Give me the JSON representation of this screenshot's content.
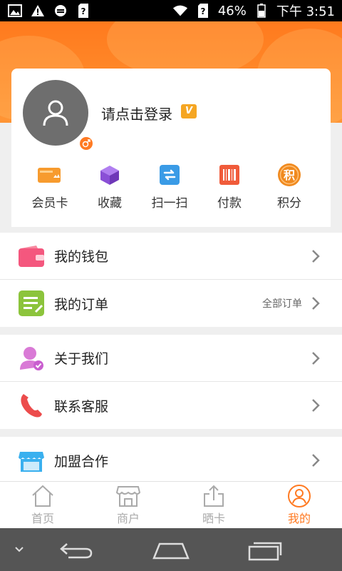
{
  "status_bar": {
    "battery_text": "46%",
    "time": "下午 3:51",
    "icons": [
      "image-icon",
      "warning-icon",
      "sync-icon",
      "sim-unknown-icon",
      "wifi-icon",
      "sim-unknown-icon",
      "battery-icon"
    ]
  },
  "profile": {
    "login_text": "请点击登录",
    "vip_badge": "V",
    "avatar_icon": "user-icon",
    "gender_icon": "male-icon"
  },
  "quick_actions": [
    {
      "label": "会员卡",
      "icon": "member-card-icon",
      "color": "#f79b2e"
    },
    {
      "label": "收藏",
      "icon": "cube-icon",
      "color": "#9b5be0"
    },
    {
      "label": "扫一扫",
      "icon": "scan-icon",
      "color": "#3a9be6"
    },
    {
      "label": "付款",
      "icon": "barcode-icon",
      "color": "#f05b3a"
    },
    {
      "label": "积分",
      "icon": "points-icon",
      "color": "#f08a1f"
    }
  ],
  "menu_group_1": [
    {
      "label": "我的钱包",
      "icon": "wallet-icon",
      "extra": ""
    },
    {
      "label": "我的订单",
      "icon": "order-icon",
      "extra": "全部订单"
    }
  ],
  "menu_group_2": [
    {
      "label": "关于我们",
      "icon": "about-user-icon",
      "extra": ""
    },
    {
      "label": "联系客服",
      "icon": "phone-icon",
      "extra": ""
    }
  ],
  "menu_group_3": [
    {
      "label": "加盟合作",
      "icon": "store-icon",
      "extra": ""
    }
  ],
  "bottom_nav": [
    {
      "label": "首页",
      "icon": "home-icon",
      "active": false
    },
    {
      "label": "商户",
      "icon": "shop-icon",
      "active": false
    },
    {
      "label": "晒卡",
      "icon": "share-icon",
      "active": false
    },
    {
      "label": "我的",
      "icon": "profile-icon",
      "active": true
    }
  ],
  "colors": {
    "accent": "#ff7a22",
    "header": "#ff8a2a",
    "inactive_nav": "#aaaaaa",
    "system_nav": "#555555"
  }
}
